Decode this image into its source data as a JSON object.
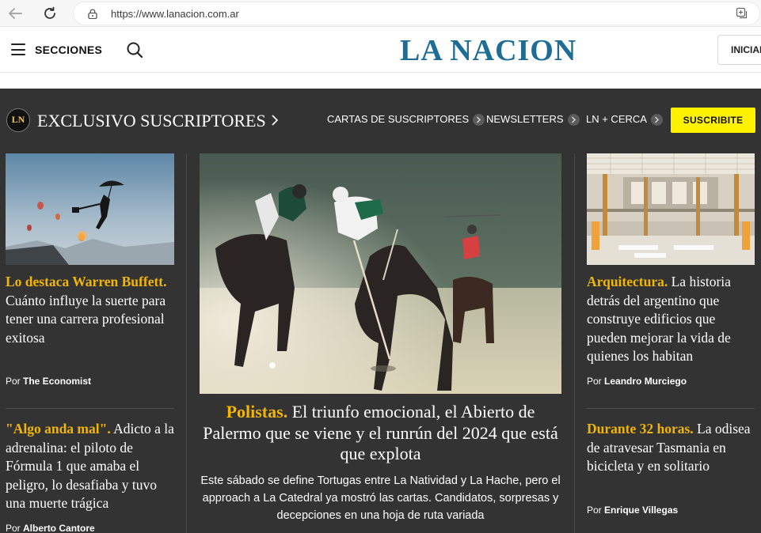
{
  "browser": {
    "url": "https://www.lanacion.com.ar"
  },
  "header": {
    "sections_label": "SECCIONES",
    "logo": "LA NACION",
    "login_label": "INICIAR"
  },
  "exclusive": {
    "badge": "LN",
    "title": "EXCLUSIVO SUSCRIPTORES",
    "links": [
      {
        "label": "CARTAS DE SUSCRIPTORES"
      },
      {
        "label": "NEWSLETTERS"
      },
      {
        "label": "LN + CERCA"
      }
    ],
    "subscribe_label": "SUSCRIBITE"
  },
  "articles": {
    "left_top": {
      "kicker": "Lo destaca Warren Buffett.",
      "headline": " Cuánto influye la suerte para tener una carrera profesional exitosa",
      "byline_prefix": "Por ",
      "author": "The Economist"
    },
    "left_bottom": {
      "kicker": "\"Algo anda mal\".",
      "headline": " Adicto a la adrenalina: el piloto de Fórmula 1 que amaba el peligro, lo desafiaba y tuvo una muerte trágica",
      "byline_prefix": "Por ",
      "author": "Alberto Cantore"
    },
    "main": {
      "kicker": "Polistas.",
      "headline": " El triunfo emocional, el Abierto de Palermo que se viene y el runrún del 2024 que está que explota",
      "summary": "Este sábado se define Tortugas entre La Natividad y La Hache, pero el approach a La Catedral ya mostró las cartas. Candidatos, sorpresas y decepciones en una hoja de ruta variada"
    },
    "right_top": {
      "kicker": "Arquitectura.",
      "headline": " La historia detrás del argentino que construye edificios que pueden mejorar la vida de quienes los habitan",
      "byline_prefix": "Por ",
      "author": "Leandro Murciego"
    },
    "right_bottom": {
      "kicker": "Durante 32 horas.",
      "headline": " La odisea de atravesar Tasmania en bicicleta y en solitario",
      "byline_prefix": "Por ",
      "author": "Enrique Villegas"
    }
  },
  "colors": {
    "logo_blue": "#1d6d97",
    "kicker_yellow": "#f2b600",
    "subscribe_yellow": "#fff200",
    "dark_bg": "#333333"
  }
}
